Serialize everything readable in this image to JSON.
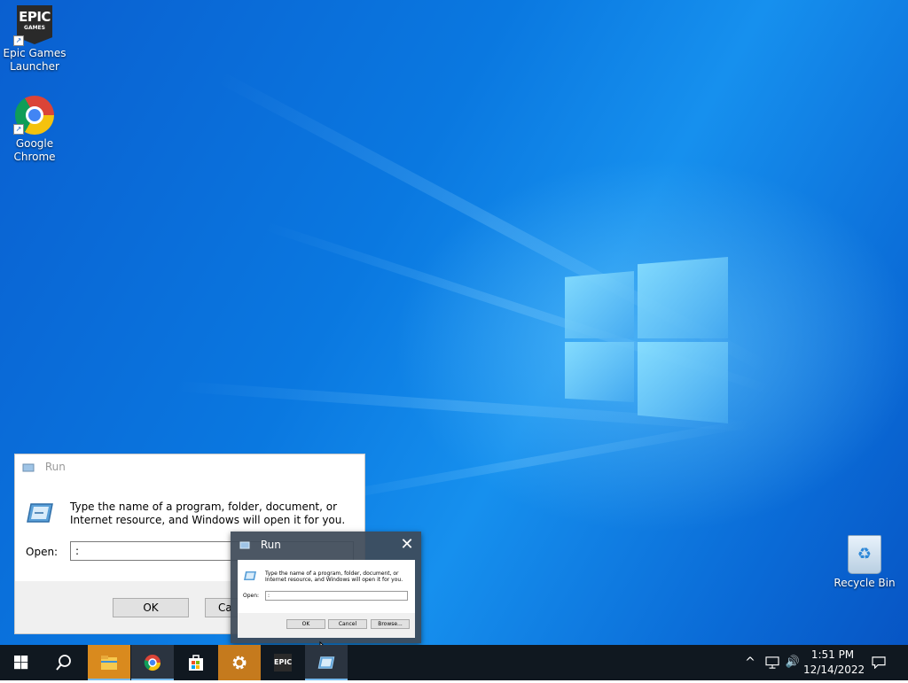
{
  "desktop": {
    "icons": [
      {
        "label": "Epic Games Launcher",
        "icon": "epic-games-icon"
      },
      {
        "label": "Google Chrome",
        "icon": "chrome-icon"
      },
      {
        "label": "Recycle Bin",
        "icon": "recycle-bin-icon"
      }
    ],
    "epic_logo": {
      "big": "EPIC",
      "small": "GAMES"
    }
  },
  "run_dialog": {
    "title": "Run",
    "description": "Type the name of a program, folder, document, or Internet resource, and Windows will open it for you.",
    "open_label": "Open:",
    "open_value": ":",
    "buttons": {
      "ok": "OK",
      "cancel": "Cancel",
      "browse": "Browse..."
    },
    "cancel_visible_fragment": "Ca"
  },
  "taskbar_preview": {
    "title": "Run",
    "close_glyph": "✕"
  },
  "taskbar": {
    "items": [
      {
        "name": "start",
        "icon": "windows-start-icon"
      },
      {
        "name": "search",
        "icon": "search-icon"
      },
      {
        "name": "file-explorer",
        "icon": "folder-icon"
      },
      {
        "name": "chrome",
        "icon": "chrome-icon"
      },
      {
        "name": "microsoft-store",
        "icon": "store-icon"
      },
      {
        "name": "settings",
        "icon": "gear-icon"
      },
      {
        "name": "epic-games",
        "icon": "epic-games-icon"
      },
      {
        "name": "run",
        "icon": "run-icon"
      }
    ],
    "epic_label": "EPIC",
    "clock_time": "1:51 PM",
    "clock_date": "12/14/2022",
    "tray": {
      "chevron": "^",
      "volume": "🔊",
      "notifications": "🗨"
    }
  },
  "colors": {
    "accent": "#76b9ed",
    "taskbar": "#101820",
    "desktop": "#0a78e0"
  }
}
